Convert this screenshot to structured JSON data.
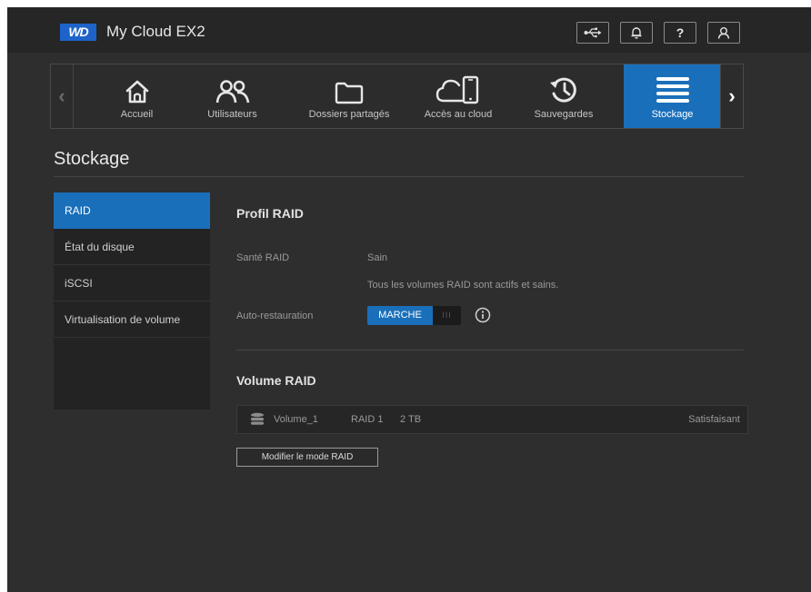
{
  "app": {
    "logo": "WD",
    "title": "My Cloud EX2"
  },
  "topbar": {
    "icons": [
      "usb-icon",
      "bell-icon",
      "help-icon",
      "user-icon"
    ],
    "help_glyph": "?"
  },
  "nav": {
    "items": [
      {
        "label": "Accueil",
        "icon": "home-icon"
      },
      {
        "label": "Utilisateurs",
        "icon": "users-icon"
      },
      {
        "label": "Dossiers partagés",
        "icon": "folder-icon"
      },
      {
        "label": "Accès au cloud",
        "icon": "cloud-device-icon"
      },
      {
        "label": "Sauvegardes",
        "icon": "history-icon"
      },
      {
        "label": "Stockage",
        "icon": "storage-icon",
        "active": true
      }
    ],
    "prev_glyph": "‹",
    "next_glyph": "›"
  },
  "page": {
    "title": "Stockage"
  },
  "sidebar": {
    "items": [
      {
        "label": "RAID",
        "active": true
      },
      {
        "label": "État du disque"
      },
      {
        "label": "iSCSI"
      },
      {
        "label": "Virtualisation de volume"
      }
    ]
  },
  "raid_profile": {
    "title": "Profil RAID",
    "health_label": "Santé RAID",
    "health_value": "Sain",
    "health_detail": "Tous les volumes RAID sont actifs et sains.",
    "auto_restore_label": "Auto-restauration",
    "auto_restore_state": "MARCHE",
    "toggle_knob": "III"
  },
  "raid_volume": {
    "title": "Volume RAID",
    "rows": [
      {
        "name": "Volume_1",
        "raid": "RAID 1",
        "size": "2 TB",
        "status": "Satisfaisant"
      }
    ],
    "modify_button": "Modifier le mode RAID"
  },
  "colors": {
    "accent": "#1a6fba",
    "background": "#2e2e2e",
    "logo": "#1d63c9"
  }
}
